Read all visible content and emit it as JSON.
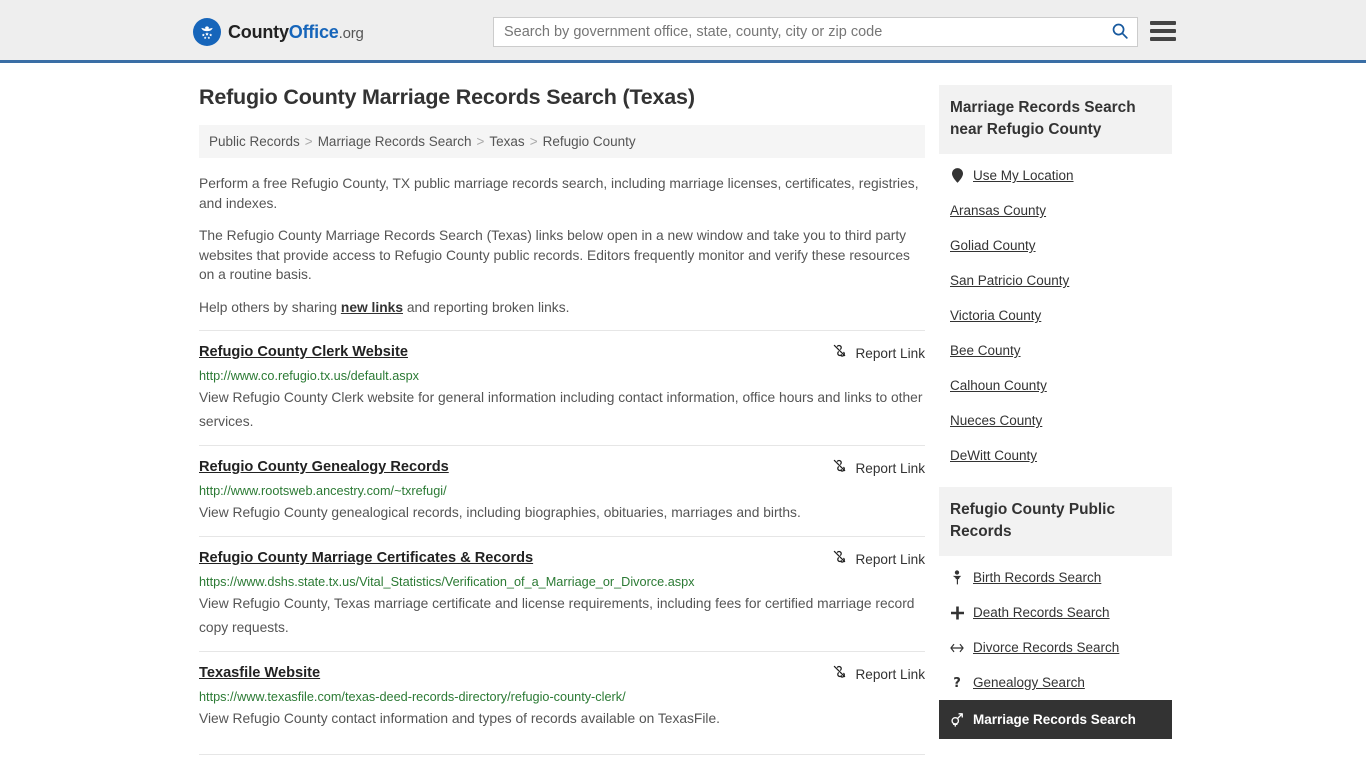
{
  "header": {
    "logo": {
      "icon": "eagle-emblem-icon",
      "text_county": "County",
      "text_office": "Office",
      "text_tld": ".org"
    },
    "search": {
      "placeholder": "Search by government office, state, county, city or zip code",
      "value": "",
      "search_icon": "search-icon"
    },
    "menu_icon": "hamburger-menu-icon",
    "accent_color": "#3a6ea5",
    "background_color": "#eeeeee"
  },
  "main": {
    "title": "Refugio County Marriage Records Search (Texas)",
    "breadcrumb": [
      {
        "label": "Public Records"
      },
      {
        "label": "Marriage Records Search"
      },
      {
        "label": "Texas"
      },
      {
        "label": "Refugio County"
      }
    ],
    "breadcrumb_separator": ">",
    "intro": {
      "p1": "Perform a free Refugio County, TX public marriage records search, including marriage licenses, certificates, registries, and indexes.",
      "p2": "The Refugio County Marriage Records Search (Texas) links below open in a new window and take you to third party websites that provide access to Refugio County public records. Editors frequently monitor and verify these resources on a routine basis.",
      "p3_before": "Help others by sharing ",
      "p3_link": "new links",
      "p3_after": " and reporting broken links."
    },
    "report_link_label": "Report Link",
    "report_link_icon": "broken-link-icon",
    "results": [
      {
        "title": "Refugio County Clerk Website",
        "url": "http://www.co.refugio.tx.us/default.aspx",
        "description": "View Refugio County Clerk website for general information including contact information, office hours and links to other services."
      },
      {
        "title": "Refugio County Genealogy Records",
        "url": "http://www.rootsweb.ancestry.com/~txrefugi/",
        "description": "View Refugio County genealogical records, including biographies, obituaries, marriages and births."
      },
      {
        "title": "Refugio County Marriage Certificates & Records",
        "url": "https://www.dshs.state.tx.us/Vital_Statistics/Verification_of_a_Marriage_or_Divorce.aspx",
        "description": "View Refugio County, Texas marriage certificate and license requirements, including fees for certified marriage record copy requests."
      },
      {
        "title": "Texasfile Website",
        "url": "https://www.texasfile.com/texas-deed-records-directory/refugio-county-clerk/",
        "description": "View Refugio County contact information and types of records available on TexasFile."
      }
    ]
  },
  "sidebar": {
    "nearby": {
      "heading": "Marriage Records Search near Refugio County",
      "items": [
        {
          "label": "Use My Location",
          "icon": "map-pin-icon",
          "glyph": "●"
        },
        {
          "label": "Aransas County",
          "icon": "",
          "glyph": ""
        },
        {
          "label": "Goliad County",
          "icon": "",
          "glyph": ""
        },
        {
          "label": "San Patricio County",
          "icon": "",
          "glyph": ""
        },
        {
          "label": "Victoria County",
          "icon": "",
          "glyph": ""
        },
        {
          "label": "Bee County",
          "icon": "",
          "glyph": ""
        },
        {
          "label": "Calhoun County",
          "icon": "",
          "glyph": ""
        },
        {
          "label": "Nueces County",
          "icon": "",
          "glyph": ""
        },
        {
          "label": "DeWitt County",
          "icon": "",
          "glyph": ""
        }
      ]
    },
    "public_records": {
      "heading": "Refugio County Public Records",
      "items": [
        {
          "label": "Birth Records Search",
          "icon": "baby-icon",
          "glyph": "\u0001",
          "active": false
        },
        {
          "label": "Death Records Search",
          "icon": "cross-icon",
          "glyph": "✚",
          "active": false
        },
        {
          "label": "Divorce Records Search",
          "icon": "left-right-arrow-icon",
          "glyph": "↔",
          "active": false
        },
        {
          "label": "Genealogy Search",
          "icon": "question-mark-icon",
          "glyph": "?",
          "active": false
        },
        {
          "label": "Marriage Records Search",
          "icon": "male-female-icon",
          "glyph": "⚤",
          "active": true
        }
      ]
    },
    "active_background_color": "#333333",
    "card_header_background": "#f2f2f2"
  }
}
